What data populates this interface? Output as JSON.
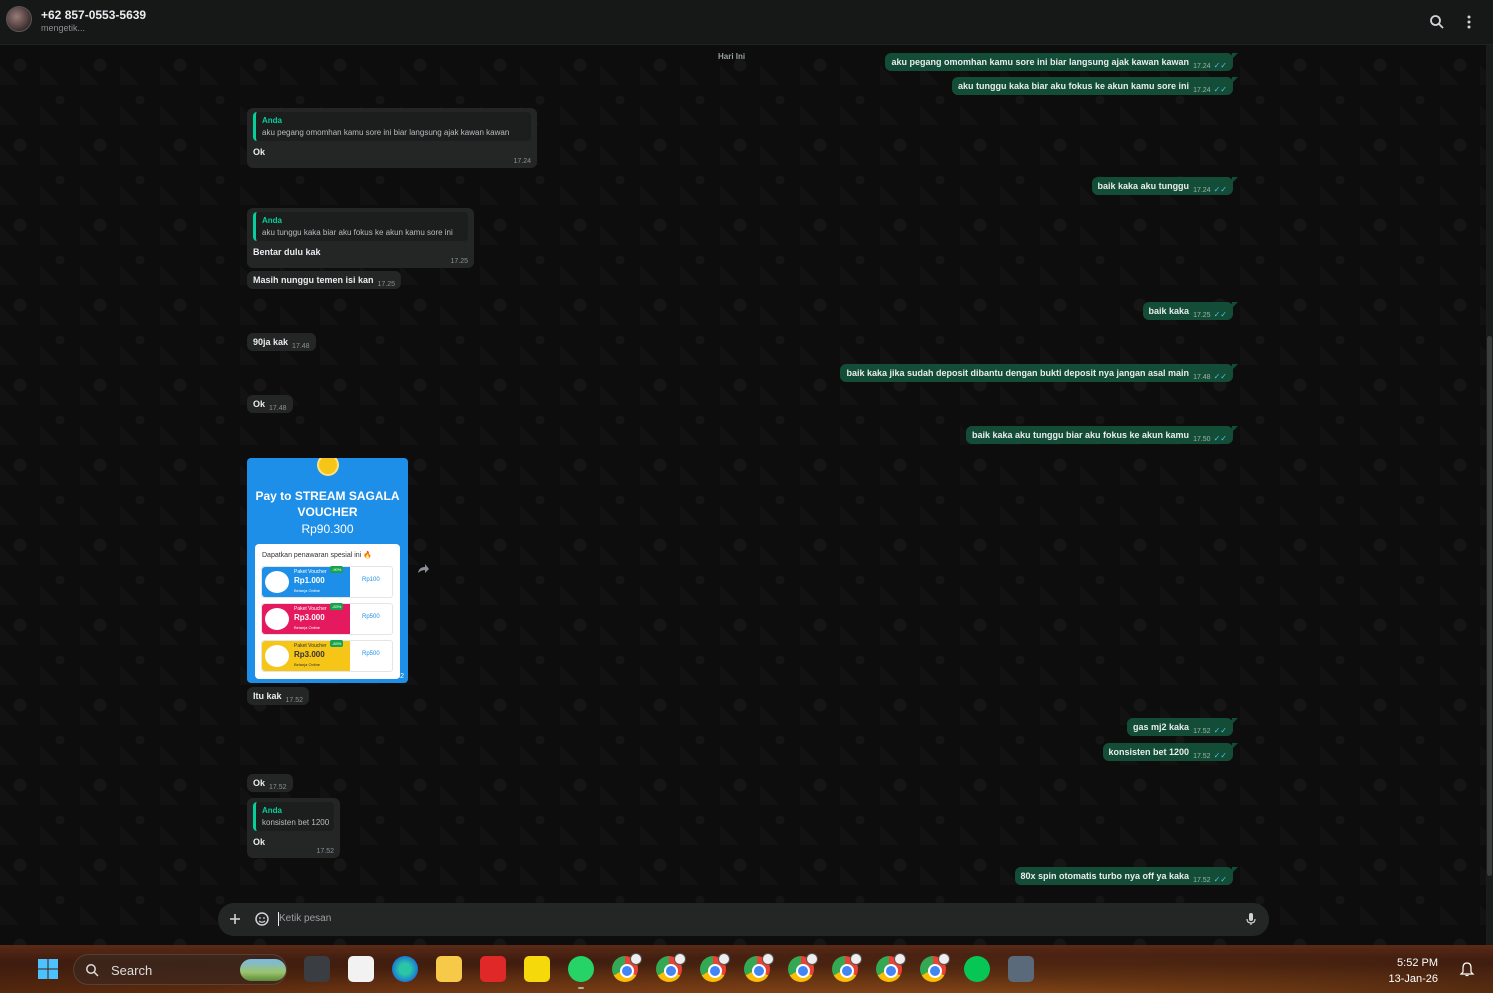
{
  "header": {
    "contact_name": "+62 857-0553-5639",
    "contact_status": "mengetik..."
  },
  "chat": {
    "date_chip": "Hari Ini",
    "messages": [
      {
        "dir": "out",
        "text": "aku pegang omomhan kamu sore ini biar langsung ajak kawan kawan",
        "time": "17.24"
      },
      {
        "dir": "out",
        "text": "aku tunggu kaka biar aku fokus ke akun kamu sore ini",
        "time": "17.24"
      },
      {
        "dir": "in",
        "quote_author": "Anda",
        "quote_text": "aku pegang omomhan kamu sore ini biar langsung ajak kawan kawan",
        "text": "Ok",
        "time": "17.24"
      },
      {
        "dir": "out",
        "text": "baik kaka aku tunggu",
        "time": "17.24"
      },
      {
        "dir": "in",
        "quote_author": "Anda",
        "quote_text": "aku tunggu kaka biar aku fokus ke akun kamu sore ini",
        "text": "Bentar dulu kak",
        "time": "17.25"
      },
      {
        "dir": "in",
        "text": "Masih nunggu temen isi kan",
        "time": "17.25"
      },
      {
        "dir": "out",
        "text": "baik kaka",
        "time": "17.25"
      },
      {
        "dir": "in",
        "text": "90ja kak",
        "time": "17.48"
      },
      {
        "dir": "out",
        "text": "baik kaka jika sudah deposit dibantu dengan bukti deposit nya jangan asal main",
        "time": "17.48"
      },
      {
        "dir": "in",
        "text": "Ok",
        "time": "17.48"
      },
      {
        "dir": "out",
        "text": "baik kaka aku tunggu biar aku fokus ke akun kamu",
        "time": "17.50"
      },
      {
        "dir": "in",
        "text": "Itu kak",
        "time": "17.52"
      },
      {
        "dir": "out",
        "text": "gas mj2 kaka",
        "time": "17.52"
      },
      {
        "dir": "out",
        "text": "konsisten bet 1200",
        "time": "17.52"
      },
      {
        "dir": "in",
        "text": "Ok",
        "time": "17.52"
      },
      {
        "dir": "in",
        "quote_author": "Anda",
        "quote_text": "konsisten bet 1200",
        "text": "Ok",
        "time": "17.52"
      },
      {
        "dir": "out",
        "text": "80x spin otomatis turbo nya off ya kaka",
        "time": "17.52"
      }
    ],
    "image_message": {
      "title": "Pay to STREAM SAGALA VOUCHER",
      "amount": "Rp90.300",
      "offer_heading": "Dapatkan penawaran spesial ini 🔥",
      "time": "17.52",
      "vouchers": [
        {
          "label": "Paket Voucher",
          "price": "Rp1.000",
          "sub": "Belanja Online",
          "badge": "-90%",
          "right": "Rp100",
          "color": "#1d8fe8"
        },
        {
          "label": "Paket Voucher",
          "price": "Rp3.000",
          "sub": "Belanja Online",
          "badge": "-83%",
          "right": "Rp500",
          "color": "#e5195e"
        },
        {
          "label": "Paket Voucher",
          "price": "Rp3.000",
          "sub": "Belanja Online",
          "badge": "-83%",
          "right": "Rp500",
          "color": "#f5c518"
        }
      ]
    },
    "tick_glyph": "✓✓"
  },
  "composer": {
    "placeholder": "Ketik pesan"
  },
  "taskbar": {
    "search_label": "Search",
    "time": "5:52 PM",
    "date": "13-Jan-26"
  },
  "colors": {
    "outgoing_bubble": "#144d37",
    "incoming_bubble": "#242626",
    "accent": "#06cf9c",
    "read_ticks": "#53bdeb"
  }
}
